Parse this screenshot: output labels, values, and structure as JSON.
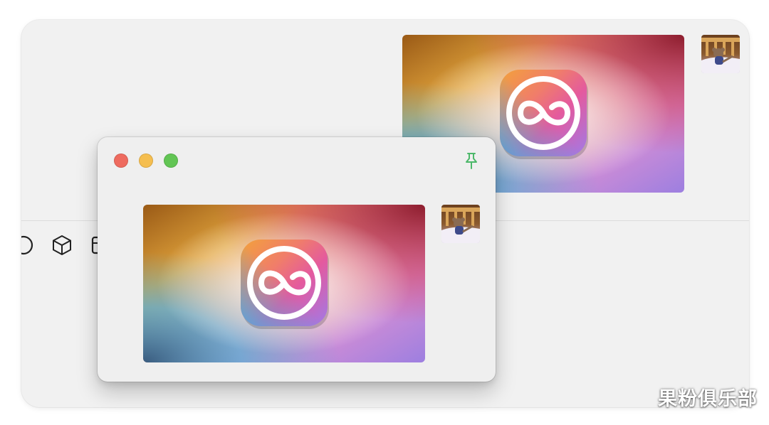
{
  "colors": {
    "close": "#ee6b5f",
    "minimize": "#f5be4f",
    "maximize": "#62c554",
    "pin": "#4cb86a",
    "window_bg": "#efefef"
  },
  "icons": {
    "pin": "pin-icon",
    "app": "infinity-app-icon",
    "toolbar": [
      "partial-circle-icon",
      "cube-icon",
      "partial-square-icon"
    ]
  },
  "watermark": {
    "text": "果粉俱乐部"
  }
}
